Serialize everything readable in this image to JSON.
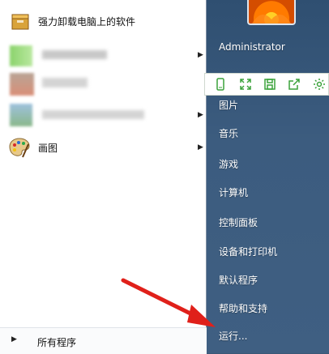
{
  "left": {
    "items": [
      {
        "label": "强力卸载电脑上的软件"
      },
      {
        "label": ""
      },
      {
        "label": ""
      },
      {
        "label": ""
      },
      {
        "label": "画图"
      }
    ],
    "all_programs": "所有程序"
  },
  "right": {
    "username": "Administrator",
    "items": [
      "图片",
      "音乐",
      "游戏",
      "计算机",
      "控制面板",
      "设备和打印机",
      "默认程序",
      "帮助和支持",
      "运行..."
    ]
  },
  "toolbar": {
    "icons": [
      "phone-icon",
      "fullscreen-icon",
      "save-icon",
      "share-icon",
      "settings-icon"
    ]
  },
  "annotation": {
    "arrow_color": "#e0201a"
  }
}
